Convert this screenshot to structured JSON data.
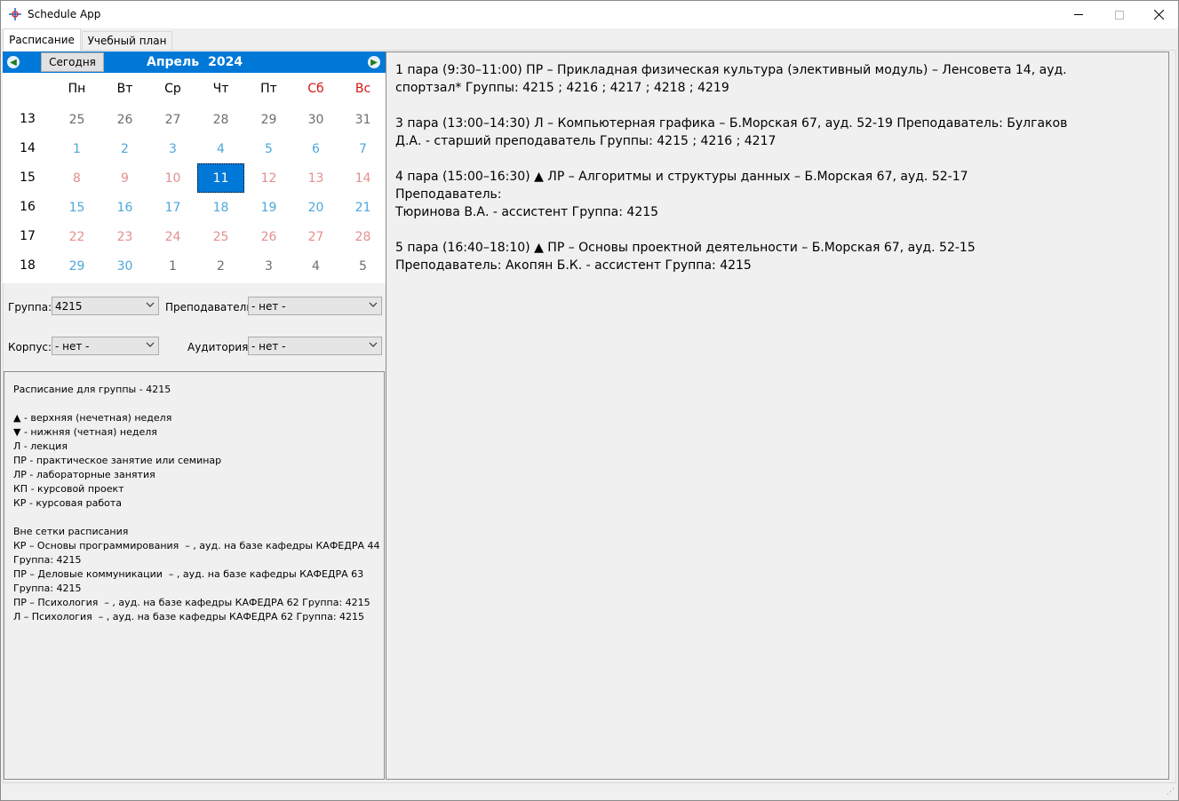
{
  "window": {
    "title": "Schedule App"
  },
  "tabs": [
    {
      "label": "Расписание"
    },
    {
      "label": "Учебный план"
    }
  ],
  "calendar": {
    "today_label": "Сегодня",
    "month": "Апрель",
    "year": "2024",
    "weekdays": [
      "Пн",
      "Вт",
      "Ср",
      "Чт",
      "Пт",
      "Сб",
      "Вс"
    ],
    "weeks": [
      {
        "num": "13",
        "days": [
          {
            "d": "25",
            "t": "other"
          },
          {
            "d": "26",
            "t": "other"
          },
          {
            "d": "27",
            "t": "other"
          },
          {
            "d": "28",
            "t": "other"
          },
          {
            "d": "29",
            "t": "other"
          },
          {
            "d": "30",
            "t": "other"
          },
          {
            "d": "31",
            "t": "other"
          }
        ]
      },
      {
        "num": "14",
        "days": [
          {
            "d": "1",
            "t": "blue"
          },
          {
            "d": "2",
            "t": "blue"
          },
          {
            "d": "3",
            "t": "blue"
          },
          {
            "d": "4",
            "t": "blue"
          },
          {
            "d": "5",
            "t": "blue"
          },
          {
            "d": "6",
            "t": "blue"
          },
          {
            "d": "7",
            "t": "blue"
          }
        ]
      },
      {
        "num": "15",
        "days": [
          {
            "d": "8",
            "t": "red"
          },
          {
            "d": "9",
            "t": "red"
          },
          {
            "d": "10",
            "t": "red"
          },
          {
            "d": "11",
            "t": "sel"
          },
          {
            "d": "12",
            "t": "red"
          },
          {
            "d": "13",
            "t": "red"
          },
          {
            "d": "14",
            "t": "red"
          }
        ]
      },
      {
        "num": "16",
        "days": [
          {
            "d": "15",
            "t": "blue"
          },
          {
            "d": "16",
            "t": "blue"
          },
          {
            "d": "17",
            "t": "blue"
          },
          {
            "d": "18",
            "t": "blue"
          },
          {
            "d": "19",
            "t": "blue"
          },
          {
            "d": "20",
            "t": "blue"
          },
          {
            "d": "21",
            "t": "blue"
          }
        ]
      },
      {
        "num": "17",
        "days": [
          {
            "d": "22",
            "t": "red"
          },
          {
            "d": "23",
            "t": "red"
          },
          {
            "d": "24",
            "t": "red"
          },
          {
            "d": "25",
            "t": "red"
          },
          {
            "d": "26",
            "t": "red"
          },
          {
            "d": "27",
            "t": "red"
          },
          {
            "d": "28",
            "t": "red"
          }
        ]
      },
      {
        "num": "18",
        "days": [
          {
            "d": "29",
            "t": "blue"
          },
          {
            "d": "30",
            "t": "blue"
          },
          {
            "d": "1",
            "t": "other"
          },
          {
            "d": "2",
            "t": "other"
          },
          {
            "d": "3",
            "t": "other"
          },
          {
            "d": "4",
            "t": "other"
          },
          {
            "d": "5",
            "t": "other"
          }
        ]
      }
    ]
  },
  "filters": {
    "group_label": "Группа:",
    "group_value": "4215",
    "teacher_label": "Преподаватель:",
    "teacher_value": "- нет -",
    "building_label": "Корпус:",
    "building_value": "- нет -",
    "room_label": "Аудитория:",
    "room_value": "- нет -"
  },
  "info_lines": [
    "Расписание для группы - 4215",
    "",
    "▲ - верхняя (нечетная) неделя",
    "▼ - нижняя (четная) неделя",
    "Л - лекция",
    "ПР - практическое занятие или семинар",
    "ЛР - лабораторные занятия",
    "КП - курсовой проект",
    "КР - курсовая работа",
    "",
    "Вне сетки расписания",
    "КР – Основы программирования  – , ауд. на базе кафедры КАФЕДРА 44",
    "Группа: 4215",
    "ПР – Деловые коммуникации  – , ауд. на базе кафедры КАФЕДРА 63",
    "Группа: 4215",
    "ПР – Психология  – , ауд. на базе кафедры КАФЕДРА 62 Группа: 4215",
    "Л – Психология  – , ауд. на базе кафедры КАФЕДРА 62 Группа: 4215"
  ],
  "lessons": [
    {
      "line1": "1 пара (9:30–11:00) ПР  – Прикладная физическая культура (элективный модуль)   – Ленсовета 14, ауд.",
      "line2": "спортзал* Группы:  4215 ;  4216 ;  4217 ;  4218 ;  4219"
    },
    {
      "line1": "3 пара (13:00–14:30) Л  – Компьютерная графика   – Б.Морская 67, ауд. 52-19 Преподаватель:  Булгаков",
      "line2": "Д.А. - старший преподаватель Группы:  4215 ;  4216 ;  4217"
    },
    {
      "line1": "4 пара (15:00–16:30) ▲ ЛР  – Алгоритмы и структуры данных   – Б.Морская 67, ауд. 52-17 Преподаватель:",
      "line2": "Тюринова В.А. - ассистент Группа:  4215"
    },
    {
      "line1": "5 пара (16:40–18:10) ▲ ПР  – Основы проектной деятельности   – Б.Морская 67, ауд. 52-15",
      "line2": "Преподаватель:  Акопян Б.К. - ассистент Группа:  4215"
    }
  ]
}
